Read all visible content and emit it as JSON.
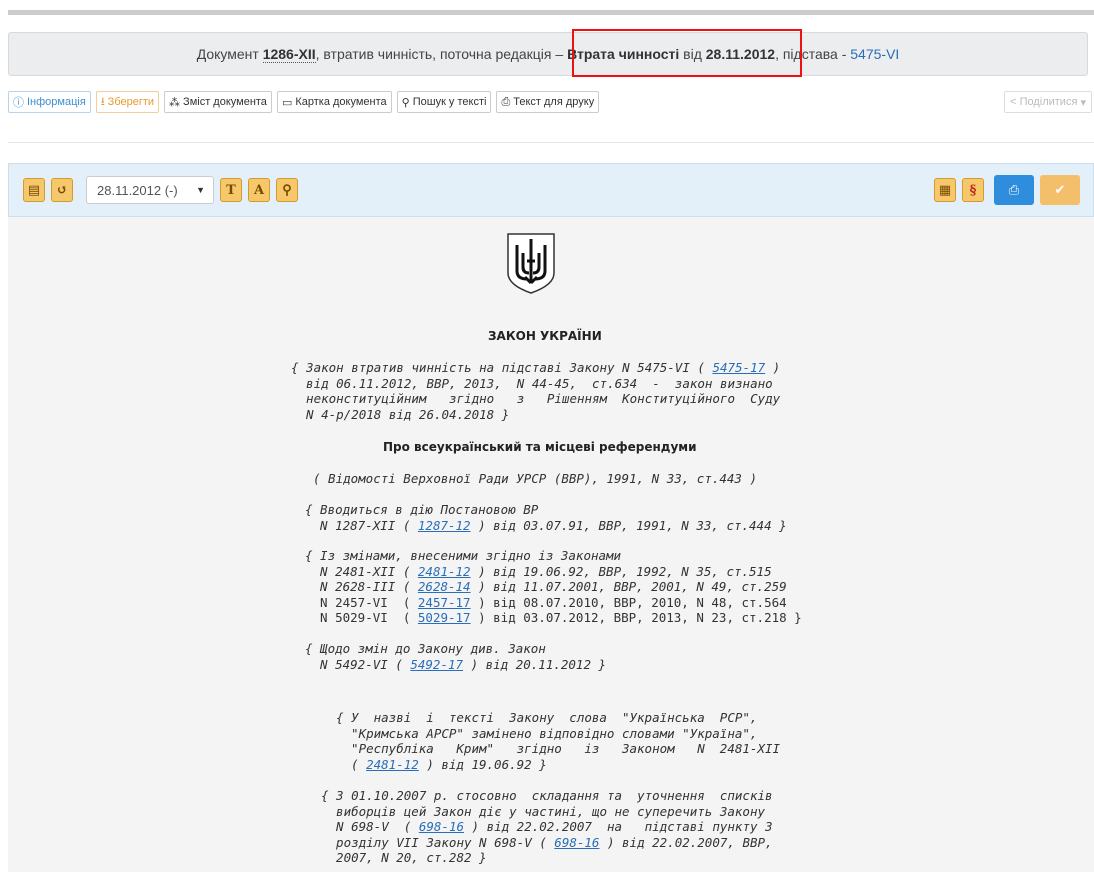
{
  "status": {
    "prefix": "Документ",
    "doc_number": "1286-XII",
    "mid": ", втратив чинність, поточна редакція –",
    "loss_label": "Втрата чинності",
    "loss_from": "від",
    "loss_date": "28.11.2012",
    "basis_label": ", підстава -",
    "basis_link": "5475-VI"
  },
  "buttons": {
    "info": "Інформація",
    "save": "Зберегти",
    "contents": "Зміст документа",
    "card": "Картка документа",
    "search": "Пошук у тексті",
    "print_text": "Текст для друку",
    "share": "Поділитися"
  },
  "toolbar": {
    "date_select": "28.11.2012 (-)",
    "icon_t": "T",
    "icon_a": "A",
    "icon_s": "§"
  },
  "document": {
    "law_title": "ЗАКОН УКРАЇНИ",
    "note1": [
      "{ Закон втратив чинність на підставі Закону N 5475-VI ( ",
      "5475-17",
      " )",
      "  від 06.11.2012, ВВР, 2013,  N 44-45,  ст.634  -  закон визнано",
      "  неконституційним   згідно   з   Рішенням  Конституційного  Суду",
      "  N 4-р/2018 від 26.04.2018 }"
    ],
    "subtitle": "Про всеукраїнський та місцеві референдуми",
    "source": "( Відомості Верховної Ради УРСР (ВВР), 1991, N 33, ст.443 )",
    "enact": [
      "{ Вводиться в дію Постановою ВР",
      "  N 1287-XII ( ",
      "1287-12",
      " ) від 03.07.91, ВВР, 1991, N 33, ст.444 }"
    ],
    "amend_head": "{ Із змінами, внесеними згідно із Законами",
    "amend_rows": [
      {
        "pre": "  N 2481-XII ( ",
        "link": "2481-12",
        "post": " ) від 19.06.92, ВВР, 1992, N 35, ст.515",
        "italic": true
      },
      {
        "pre": "  N 2628-III ( ",
        "link": "2628-14",
        "post": " ) від 11.07.2001, ВВР, 2001, N 49, ст.259",
        "italic": true
      },
      {
        "pre": "  N 2457-VI  ( ",
        "link": "2457-17",
        "post": " ) від 08.07.2010, ВВР, 2010, N 48, ст.564",
        "italic": false
      },
      {
        "pre": "  N 5029-VI  ( ",
        "link": "5029-17",
        "post": " ) від 03.07.2012, ВВР, 2013, N 23, ст.218 }",
        "italic": false
      }
    ],
    "changes_head": "{ Щодо змін до Закону див. Закон",
    "changes_pre": "  N 5492-VI ( ",
    "changes_link": "5492-17",
    "changes_post": " ) від 20.11.2012 }",
    "rename": [
      "{ У  назві  і  тексті  Закону  слова  \"Українська  РСР\",",
      "  \"Кримська АРСР\" замінено відповідно словами \"Україна\",",
      "  \"Республіка   Крим\"   згідно   із   Законом   N  2481-XII",
      "  ( ",
      "2481-12",
      " ) від 19.06.92 }"
    ],
    "since": [
      "{ З 01.10.2007 р. стосовно  складання та  уточнення  списків",
      "  виборців цей Закон діє у частині, що не суперечить Закону",
      "  N 698-V  ( ",
      "698-16",
      " ) від 22.02.2007  на   підставі пункту 3",
      "  розділу VII Закону N 698-V ( ",
      "698-16",
      " ) від 22.02.2007, ВВР,",
      "  2007, N 20, ст.282 }"
    ]
  }
}
